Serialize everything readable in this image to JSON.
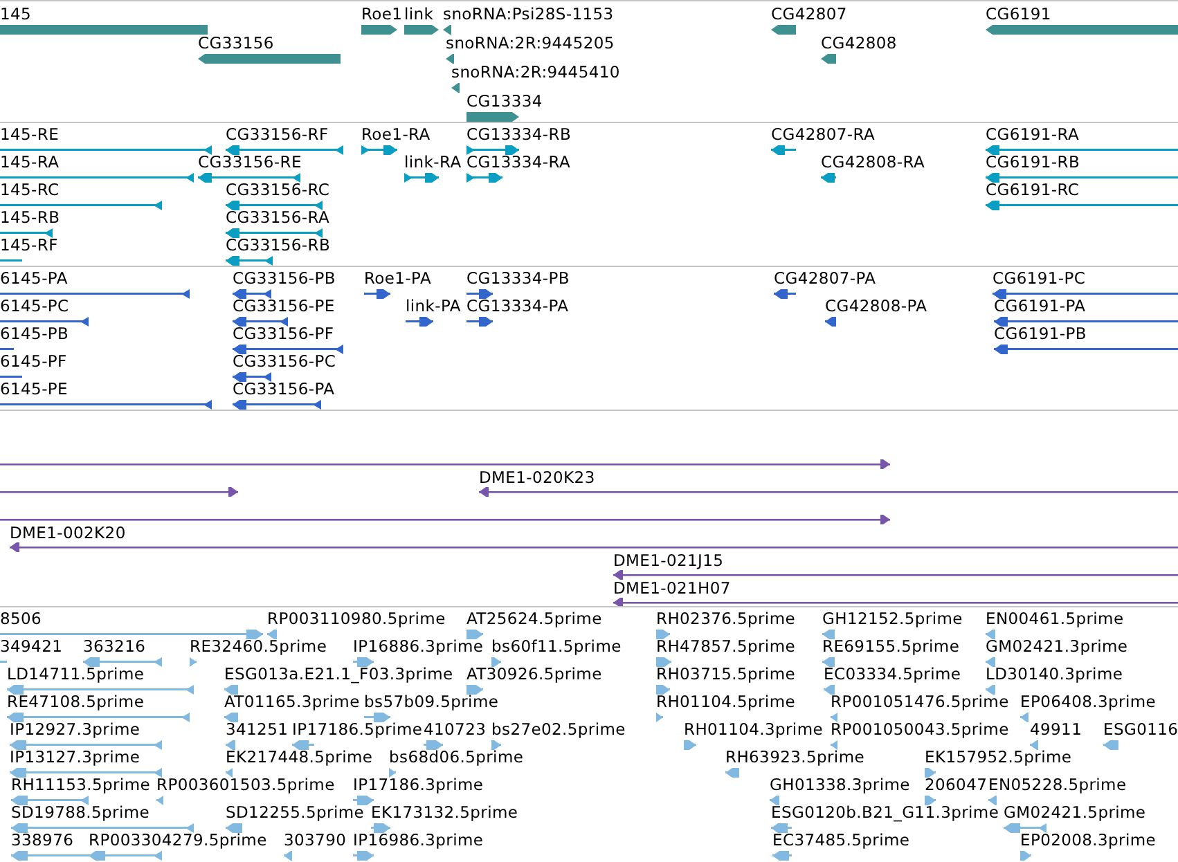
{
  "tracks": [
    {
      "kind": "gene",
      "features": [
        {
          "label": "145",
          "reverse": true
        },
        {
          "label": "CG33156",
          "reverse": true
        },
        {
          "label": "Roe1",
          "reverse": false
        },
        {
          "label": "link",
          "reverse": false
        },
        {
          "label": "snoRNA:Psi28S-1153",
          "reverse": true
        },
        {
          "label": "snoRNA:2R:9445205",
          "reverse": true
        },
        {
          "label": "snoRNA:2R:9445410",
          "reverse": true
        },
        {
          "label": "CG13334",
          "reverse": false
        },
        {
          "label": "CG42807",
          "reverse": true
        },
        {
          "label": "CG42808",
          "reverse": true
        },
        {
          "label": "CG6191",
          "reverse": true
        }
      ]
    },
    {
      "kind": "transcript",
      "features": [
        {
          "label": "145-RE",
          "reverse": true
        },
        {
          "label": "CG33156-RF",
          "reverse": true
        },
        {
          "label": "Roe1-RA",
          "reverse": false
        },
        {
          "label": "CG13334-RB",
          "reverse": false
        },
        {
          "label": "CG42807-RA",
          "reverse": true
        },
        {
          "label": "CG6191-RA",
          "reverse": true
        },
        {
          "label": "145-RA",
          "reverse": true
        },
        {
          "label": "CG33156-RE",
          "reverse": true
        },
        {
          "label": "link-RA",
          "reverse": false
        },
        {
          "label": "CG13334-RA",
          "reverse": false
        },
        {
          "label": "CG42808-RA",
          "reverse": true
        },
        {
          "label": "CG6191-RB",
          "reverse": true
        },
        {
          "label": "145-RC",
          "reverse": true
        },
        {
          "label": "CG33156-RC",
          "reverse": true
        },
        {
          "label": "CG6191-RC",
          "reverse": true
        },
        {
          "label": "145-RB",
          "reverse": true
        },
        {
          "label": "CG33156-RA",
          "reverse": true
        },
        {
          "label": "145-RF",
          "reverse": true
        },
        {
          "label": "CG33156-RB",
          "reverse": true
        }
      ]
    },
    {
      "kind": "protein",
      "features": [
        {
          "label": "6145-PA",
          "reverse": true
        },
        {
          "label": "CG33156-PB",
          "reverse": true
        },
        {
          "label": "Roe1-PA",
          "reverse": false
        },
        {
          "label": "CG13334-PB",
          "reverse": false
        },
        {
          "label": "CG42807-PA",
          "reverse": true
        },
        {
          "label": "CG6191-PC",
          "reverse": true
        },
        {
          "label": "6145-PC",
          "reverse": true
        },
        {
          "label": "CG33156-PE",
          "reverse": true
        },
        {
          "label": "link-PA",
          "reverse": false
        },
        {
          "label": "CG13334-PA",
          "reverse": false
        },
        {
          "label": "CG42808-PA",
          "reverse": true
        },
        {
          "label": "CG6191-PA",
          "reverse": true
        },
        {
          "label": "6145-PB",
          "reverse": true
        },
        {
          "label": "CG33156-PF",
          "reverse": true
        },
        {
          "label": "CG6191-PB",
          "reverse": true
        },
        {
          "label": "6145-PF",
          "reverse": true
        },
        {
          "label": "CG33156-PC",
          "reverse": true
        },
        {
          "label": "6145-PE",
          "reverse": true
        },
        {
          "label": "CG33156-PA",
          "reverse": true
        }
      ]
    },
    {
      "kind": "clone",
      "features": [
        {
          "reverse": false
        },
        {
          "reverse": false
        },
        {
          "label": "DME1-020K23",
          "reverse": true
        },
        {
          "reverse": false
        },
        {
          "label": "DME1-002K20",
          "reverse": true
        },
        {
          "label": "DME1-021J15",
          "reverse": true
        },
        {
          "label": "DME1-021H07",
          "reverse": true
        }
      ]
    },
    {
      "kind": "est",
      "features": [
        {
          "label": "8506",
          "reverse": false
        },
        {
          "label": "RP003110980.5prime",
          "reverse": true
        },
        {
          "label": "AT25624.5prime",
          "reverse": false
        },
        {
          "label": "RH02376.5prime",
          "reverse": false
        },
        {
          "label": "GH12152.5prime",
          "reverse": true
        },
        {
          "label": "EN00461.5prime",
          "reverse": true
        },
        {
          "label": "349421",
          "reverse": true
        },
        {
          "label": "363216",
          "reverse": true
        },
        {
          "label": "RE32460.5prime",
          "reverse": false
        },
        {
          "label": "IP16886.3prime",
          "reverse": false
        },
        {
          "label": "bs60f11.5prime",
          "reverse": false
        },
        {
          "label": "RH47857.5prime",
          "reverse": false
        },
        {
          "label": "RE69155.5prime",
          "reverse": true
        },
        {
          "label": "GM02421.3prime",
          "reverse": true
        },
        {
          "label": "LD14711.5prime",
          "reverse": true
        },
        {
          "label": "ESG013a.E21.1_F03.3prime",
          "reverse": true
        },
        {
          "label": "AT30926.5prime",
          "reverse": false
        },
        {
          "label": "RH03715.5prime",
          "reverse": false
        },
        {
          "label": "EC03334.5prime",
          "reverse": true
        },
        {
          "label": "LD30140.3prime",
          "reverse": true
        },
        {
          "label": "RE47108.5prime",
          "reverse": true
        },
        {
          "label": "AT01165.3prime",
          "reverse": true
        },
        {
          "label": "bs57b09.5prime",
          "reverse": false
        },
        {
          "label": "RH01104.5prime",
          "reverse": false
        },
        {
          "label": "RP001051476.5prime",
          "reverse": true
        },
        {
          "label": "EP06408.3prime",
          "reverse": true
        },
        {
          "label": "IP12927.3prime",
          "reverse": true
        },
        {
          "label": "341251",
          "reverse": true
        },
        {
          "label": "IP17186.5prime",
          "reverse": true
        },
        {
          "label": "410723",
          "reverse": false
        },
        {
          "label": "bs27e02.5prime",
          "reverse": false
        },
        {
          "label": "RH01104.3prime",
          "reverse": false
        },
        {
          "label": "RP001050043.5prime",
          "reverse": true
        },
        {
          "label": "49911",
          "reverse": true
        },
        {
          "label": "ESG0116",
          "reverse": true
        },
        {
          "label": "IP13127.3prime",
          "reverse": true
        },
        {
          "label": "EK217448.5prime",
          "reverse": true
        },
        {
          "label": "bs68d06.5prime",
          "reverse": false
        },
        {
          "label": "RH63923.5prime",
          "reverse": true
        },
        {
          "label": "EK157952.5prime",
          "reverse": false
        },
        {
          "label": "RH11153.5prime",
          "reverse": true
        },
        {
          "label": "RP003601503.5prime",
          "reverse": true
        },
        {
          "label": "IP17186.3prime",
          "reverse": false
        },
        {
          "label": "GH01338.3prime",
          "reverse": true
        },
        {
          "label": "206047",
          "reverse": false
        },
        {
          "label": "EN05228.5prime",
          "reverse": true
        },
        {
          "label": "SD19788.5prime",
          "reverse": true
        },
        {
          "label": "SD12255.5prime",
          "reverse": true
        },
        {
          "label": "EK173132.5prime",
          "reverse": false
        },
        {
          "label": "ESG0120b.B21_G11.3prime",
          "reverse": true
        },
        {
          "label": "GM02421.5prime",
          "reverse": true
        },
        {
          "label": "338976",
          "reverse": true
        },
        {
          "label": "RP003304279.5prime",
          "reverse": true
        },
        {
          "label": "303790",
          "reverse": true
        },
        {
          "label": "IP16986.3prime",
          "reverse": false
        },
        {
          "label": "EC37485.5prime",
          "reverse": true
        },
        {
          "label": "EP02008.3prime",
          "reverse": false
        }
      ]
    }
  ]
}
